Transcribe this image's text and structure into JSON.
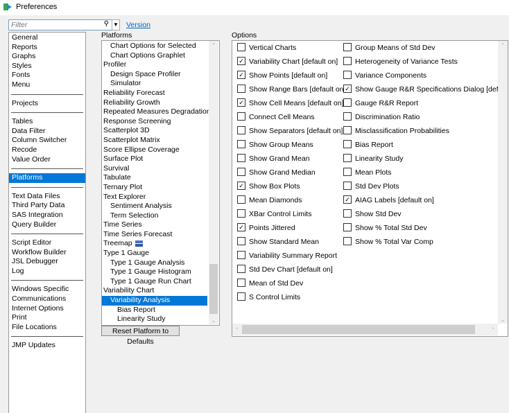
{
  "window": {
    "title": "Preferences"
  },
  "filter": {
    "placeholder": "Filter"
  },
  "version_link": "Version",
  "categories": [
    [
      "General",
      "Reports",
      "Graphs",
      "Styles",
      "Fonts",
      "Menu"
    ],
    [
      "Projects"
    ],
    [
      "Tables",
      "Data Filter",
      "Column Switcher",
      "Recode",
      "Value Order"
    ],
    [
      "Platforms"
    ],
    [
      "Text Data Files",
      "Third Party Data",
      "SAS Integration",
      "Query Builder"
    ],
    [
      "Script Editor",
      "Workflow Builder",
      "JSL Debugger",
      "Log"
    ],
    [
      "Windows Specific",
      "Communications",
      "Internet Options",
      "Print",
      "File Locations"
    ],
    [
      "JMP Updates"
    ]
  ],
  "selected_category": "Platforms",
  "platforms_label": "Platforms",
  "platforms": [
    {
      "label": "Chart Options for Selected",
      "level": 1
    },
    {
      "label": "Chart Options Graphlet",
      "level": 1
    },
    {
      "label": "Profiler",
      "level": 0
    },
    {
      "label": "Design Space Profiler",
      "level": 1
    },
    {
      "label": "Simulator",
      "level": 1
    },
    {
      "label": "Reliability Forecast",
      "level": 0
    },
    {
      "label": "Reliability Growth",
      "level": 0
    },
    {
      "label": "Repeated Measures Degradation",
      "level": 0
    },
    {
      "label": "Response Screening",
      "level": 0
    },
    {
      "label": "Scatterplot 3D",
      "level": 0
    },
    {
      "label": "Scatterplot Matrix",
      "level": 0
    },
    {
      "label": "Score Ellipse Coverage",
      "level": 0
    },
    {
      "label": "Surface Plot",
      "level": 0
    },
    {
      "label": "Survival",
      "level": 0
    },
    {
      "label": "Tabulate",
      "level": 0
    },
    {
      "label": "Ternary Plot",
      "level": 0
    },
    {
      "label": "Text Explorer",
      "level": 0
    },
    {
      "label": "Sentiment Analysis",
      "level": 1
    },
    {
      "label": "Term Selection",
      "level": 1
    },
    {
      "label": "Time Series",
      "level": 0
    },
    {
      "label": "Time Series Forecast",
      "level": 0
    },
    {
      "label": "Treemap",
      "level": 0,
      "icon": "treemap-icon"
    },
    {
      "label": "Type 1 Gauge",
      "level": 0
    },
    {
      "label": "Type 1 Gauge Analysis",
      "level": 1
    },
    {
      "label": "Type 1 Gauge Histogram",
      "level": 1
    },
    {
      "label": "Type 1 Gauge Run Chart",
      "level": 1
    },
    {
      "label": "Variability Chart",
      "level": 0
    },
    {
      "label": "Variability Analysis",
      "level": 1,
      "selected": true
    },
    {
      "label": "Bias Report",
      "level": 2
    },
    {
      "label": "Linearity Study",
      "level": 2
    }
  ],
  "reset_button": "Reset Platform to Defaults",
  "options_label": "Options",
  "options_col1": [
    {
      "label": "Vertical Charts",
      "checked": false
    },
    {
      "label": "Variability Chart [default on]",
      "checked": true
    },
    {
      "label": "Show Points [default on]",
      "checked": true
    },
    {
      "label": "Show Range Bars [default on]",
      "checked": false
    },
    {
      "label": "Show Cell Means [default on]",
      "checked": true
    },
    {
      "label": "Connect Cell Means",
      "checked": false
    },
    {
      "label": "Show Separators [default on]",
      "checked": false
    },
    {
      "label": "Show Group Means",
      "checked": false
    },
    {
      "label": "Show Grand Mean",
      "checked": false
    },
    {
      "label": "Show Grand Median",
      "checked": false
    },
    {
      "label": "Show Box Plots",
      "checked": true
    },
    {
      "label": "Mean Diamonds",
      "checked": false
    },
    {
      "label": "XBar Control Limits",
      "checked": false
    },
    {
      "label": "Points Jittered",
      "checked": true
    },
    {
      "label": "Show Standard Mean",
      "checked": false
    },
    {
      "label": "Variability Summary Report",
      "checked": false
    },
    {
      "label": "Std Dev Chart [default on]",
      "checked": false
    },
    {
      "label": "Mean of Std Dev",
      "checked": false
    },
    {
      "label": "S Control Limits",
      "checked": false
    }
  ],
  "options_col2": [
    {
      "label": "Group Means of Std Dev",
      "checked": false
    },
    {
      "label": "Heterogeneity of Variance Tests",
      "checked": false
    },
    {
      "label": "Variance Components",
      "checked": false
    },
    {
      "label": "Show Gauge R&R Specifications Dialog [default on]",
      "checked": true
    },
    {
      "label": "Gauge R&R Report",
      "checked": false
    },
    {
      "label": "Discrimination Ratio",
      "checked": false
    },
    {
      "label": "Misclassification Probabilities",
      "checked": false
    },
    {
      "label": "Bias Report",
      "checked": false
    },
    {
      "label": "Linearity Study",
      "checked": false
    },
    {
      "label": "Mean Plots",
      "checked": false
    },
    {
      "label": "Std Dev Plots",
      "checked": false
    },
    {
      "label": "AIAG Labels [default on]",
      "checked": true
    },
    {
      "label": "Show Std Dev",
      "checked": false
    },
    {
      "label": "Show % Total Std Dev",
      "checked": false
    },
    {
      "label": "Show % Total Var Comp",
      "checked": false
    }
  ]
}
